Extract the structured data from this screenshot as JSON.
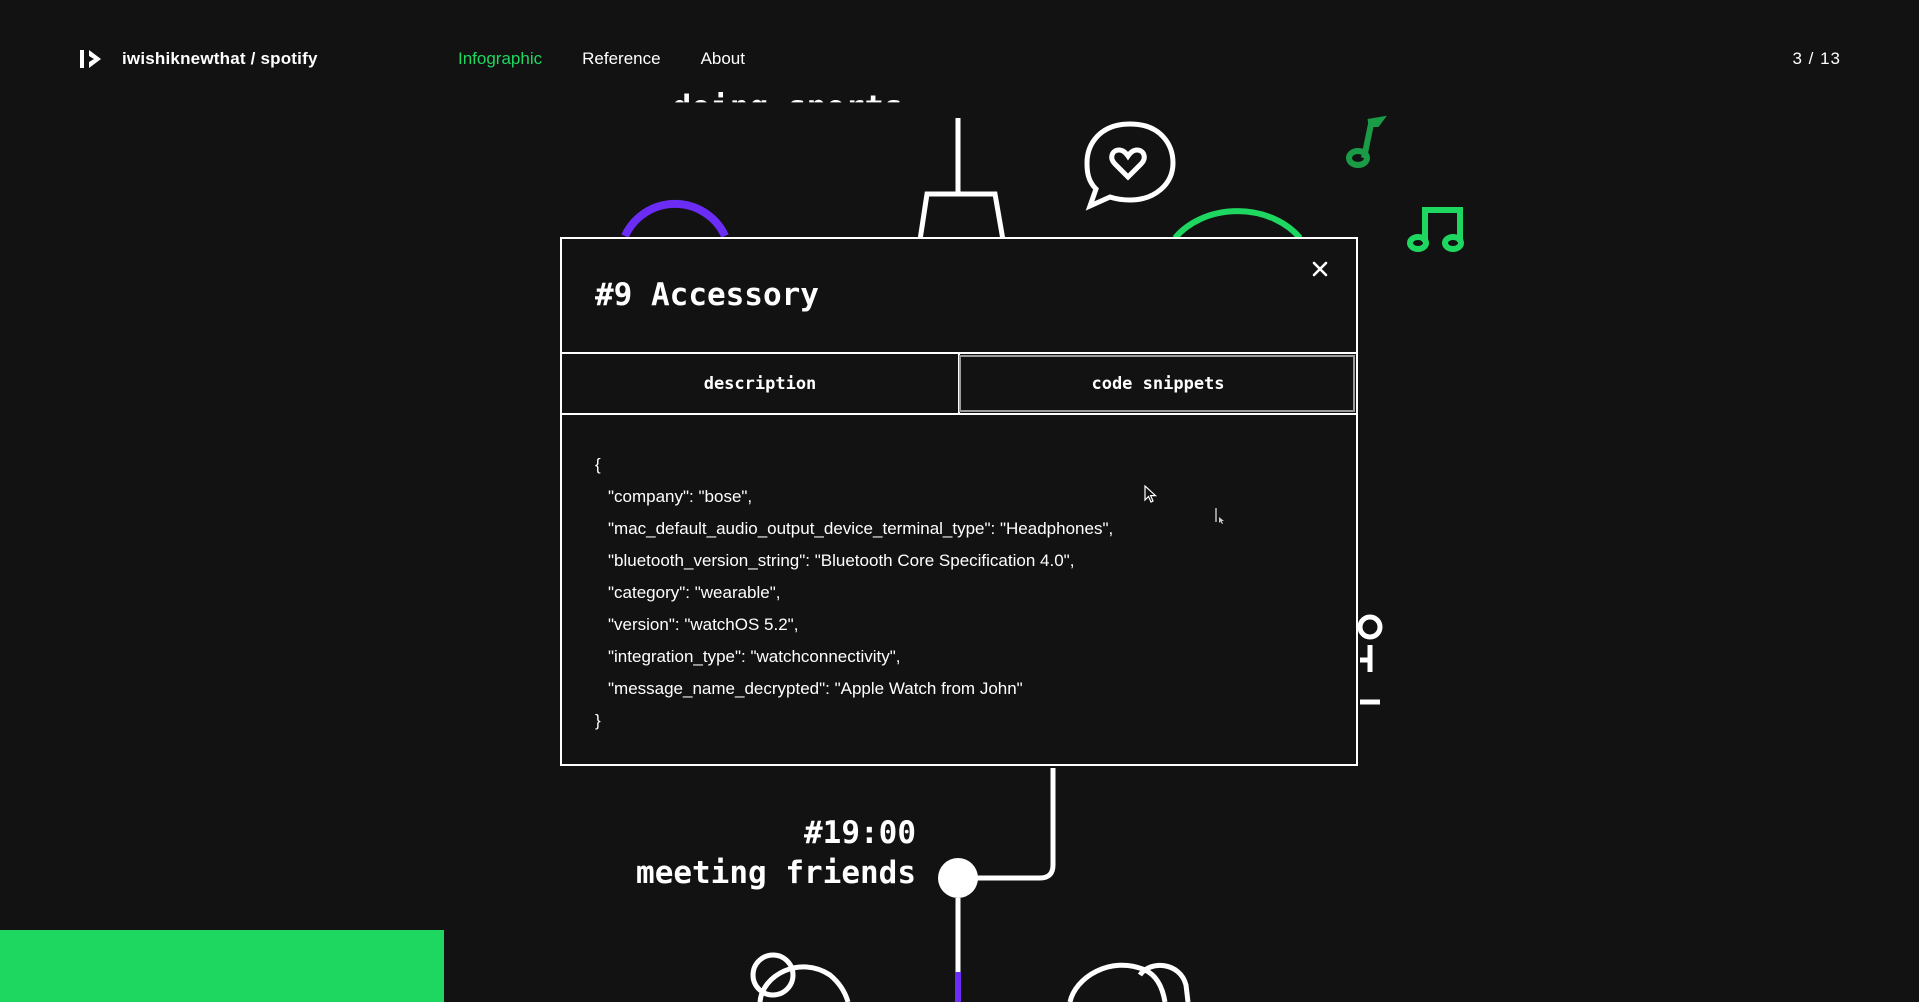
{
  "header": {
    "brand": "iwishiknewthat / spotify",
    "nav": [
      {
        "label": "Infographic",
        "active": true
      },
      {
        "label": "Reference",
        "active": false
      },
      {
        "label": "About",
        "active": false
      }
    ],
    "pager": "3 / 13"
  },
  "background": {
    "cut_heading": "doing sports",
    "time": "#19:00",
    "event": "meeting friends",
    "icons": [
      "heart-speech-bubble-icon",
      "music-note-icon",
      "music-notes-icon"
    ],
    "colors": {
      "green": "#1ed760",
      "purple": "#6b2cf5",
      "dark_green": "#1a9b45"
    }
  },
  "modal": {
    "title": "#9 Accessory",
    "tabs": [
      {
        "label": "description",
        "selected": false
      },
      {
        "label": "code snippets",
        "selected": true
      }
    ],
    "code": {
      "open": "{",
      "lines": [
        "\"company\": \"bose\",",
        "\"mac_default_audio_output_device_terminal_type\": \"Headphones\",",
        "\"bluetooth_version_string\": \"Bluetooth Core Specification 4.0\",",
        "\"category\": \"wearable\",",
        "\"version\": \"watchOS 5.2\",",
        "\"integration_type\": \"watchconnectivity\",",
        "\"message_name_decrypted\": \"Apple Watch from John\""
      ],
      "close": "}"
    }
  }
}
